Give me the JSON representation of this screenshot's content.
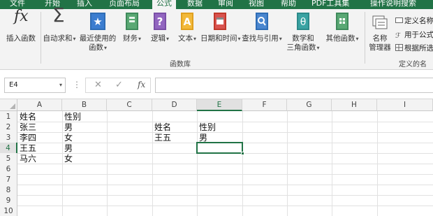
{
  "tabs": [
    "文件",
    "开始",
    "插入",
    "页面布局",
    "公式",
    "数据",
    "审阅",
    "视图",
    "帮助",
    "PDF工具集",
    "操作说明搜索"
  ],
  "active_tab": "公式",
  "ribbon": {
    "insert_function": "插入函数",
    "autosum_l1": "自动求和",
    "recent_l1": "最近使用的",
    "recent_l2": "函数",
    "financial": "财务",
    "logical": "逻辑",
    "text": "文本",
    "datetime": "日期和时间",
    "lookup": "查找与引用",
    "math_l1": "数学和",
    "math_l2": "三角函数",
    "more": "其他函数",
    "library_group": "函数库",
    "name_manager_l1": "名称",
    "name_manager_l2": "管理器",
    "define_name": "定义名称",
    "use_in_formula": "用于公式",
    "create_from_selection": "根据所选",
    "defined_names_group": "定义的名称"
  },
  "formula_bar": {
    "name_box": "E4",
    "cancel_glyph": "✕",
    "enter_glyph": "✓",
    "fx": "fx",
    "content": ""
  },
  "columns": [
    "A",
    "B",
    "C",
    "D",
    "E",
    "F",
    "G",
    "H",
    "I"
  ],
  "rows": [
    "1",
    "2",
    "3",
    "4",
    "5",
    "6",
    "7",
    "8",
    "9",
    "10"
  ],
  "cells": {
    "A1": "姓名",
    "B1": "性别",
    "A2": "张三",
    "B2": "男",
    "A3": "李四",
    "B3": "女",
    "A4": "王五",
    "B4": "男",
    "A5": "马六",
    "B5": "女",
    "D2": "姓名",
    "E2": "性别",
    "D3": "王五",
    "E3": "男"
  },
  "colors": {
    "accent": "#217346",
    "ribbon_bg": "#f3f3f3"
  }
}
